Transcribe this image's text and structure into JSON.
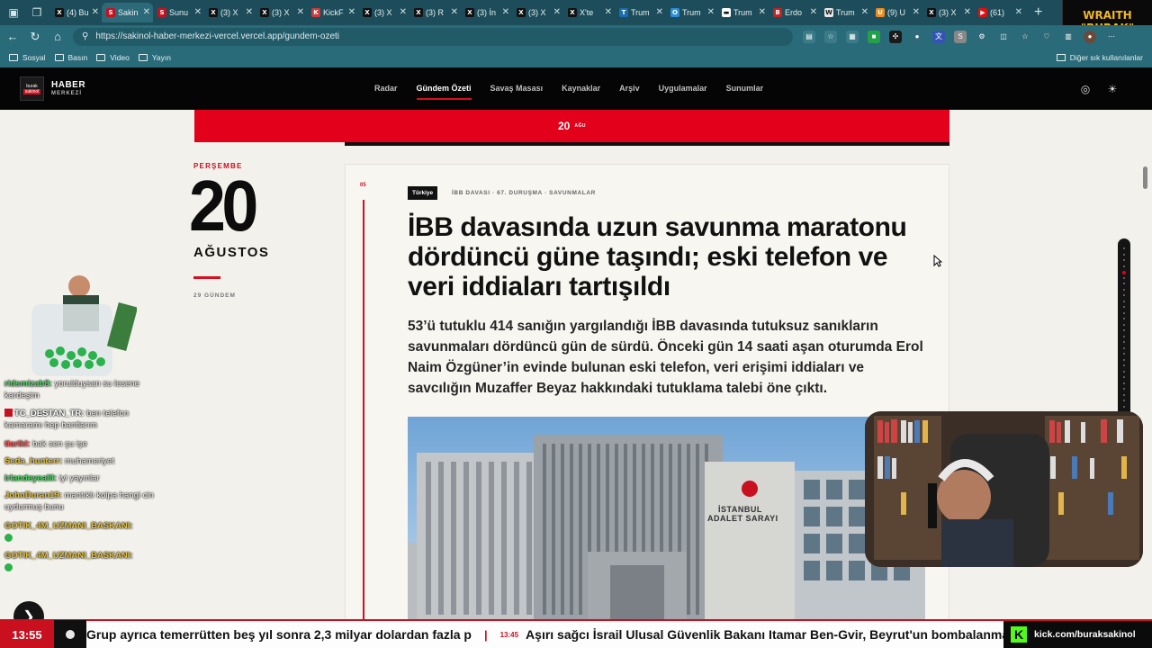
{
  "browser": {
    "tabs": [
      {
        "title": "(4) Bu",
        "fav_color": "#111111",
        "fav": "X"
      },
      {
        "title": "Sakin",
        "fav_color": "#c8101f",
        "fav": "S",
        "active": true
      },
      {
        "title": "Sunu",
        "fav_color": "#c8101f",
        "fav": "S"
      },
      {
        "title": "(3) X",
        "fav_color": "#111111",
        "fav": "X"
      },
      {
        "title": "(3) X",
        "fav_color": "#111111",
        "fav": "X"
      },
      {
        "title": "KickF",
        "fav_color": "#d13a3a",
        "fav": "K"
      },
      {
        "title": "(3) X",
        "fav_color": "#111111",
        "fav": "X"
      },
      {
        "title": "(3) R",
        "fav_color": "#111111",
        "fav": "X"
      },
      {
        "title": "(3) İn",
        "fav_color": "#111111",
        "fav": "X"
      },
      {
        "title": "(3) X",
        "fav_color": "#111111",
        "fav": "X"
      },
      {
        "title": "X'te",
        "fav_color": "#111111",
        "fav": "X"
      },
      {
        "title": "Trum",
        "fav_color": "#1b6db0",
        "fav": "T"
      },
      {
        "title": "Trum",
        "fav_color": "#2a8fd8",
        "fav": "O"
      },
      {
        "title": "Trum",
        "fav_color": "#ffffff",
        "fav": "▬"
      },
      {
        "title": "Erdo",
        "fav_color": "#c02323",
        "fav": "B"
      },
      {
        "title": "Trum",
        "fav_color": "#e8e8e8",
        "fav": "W"
      },
      {
        "title": "(9) U",
        "fav_color": "#f08a1c",
        "fav": "U"
      },
      {
        "title": "(3) X",
        "fav_color": "#111111",
        "fav": "X"
      },
      {
        "title": "(61)",
        "fav_color": "#e01010",
        "fav": "▶"
      }
    ],
    "url": "https://sakinol-haber-merkezi-vercel.vercel.app/gundem-ozeti",
    "bookmarks": [
      "Sosyal",
      "Basın",
      "Video",
      "Yayın"
    ],
    "bookmarks_right": "Diğer sık kullanılanlar"
  },
  "site": {
    "logo_title": "HABER",
    "logo_sub": "MERKEZİ",
    "logo_mark_top": "burak",
    "logo_mark_bottom": "sakinol",
    "nav": [
      "Radar",
      "Gündem Özeti",
      "Savaş Masası",
      "Kaynaklar",
      "Arşiv",
      "Uygulamalar",
      "Sunumlar"
    ],
    "nav_active": "Gündem Özeti"
  },
  "banner": {
    "day": "20",
    "month_short": "AĞU"
  },
  "date_column": {
    "weekday": "PERŞEMBE",
    "day": "20",
    "month": "AĞUSTOS",
    "count_label": "29 GÜNDEM"
  },
  "article": {
    "index": "05",
    "region_tag": "Türkiye",
    "meta": "İBB DAVASI · 67. DURUŞMA · SAVUNMALAR",
    "headline": "İBB davasında uzun savunma maratonu dördüncü güne taşındı; eski telefon ve veri iddiaları tartışıldı",
    "lede": "53’ü tutuklu 414 sanığın yargılandığı İBB davasında tutuksuz sanıkların savunmaları dördüncü gün de sürdü. Önceki gün 14 saati aşan oturumda Erol Naim Özgüner’in evinde bulunan eski telefon, veri erişimi iddiaları ve savcılığın Muzaffer Beyaz hakkındaki tutuklama talebi öne çıktı.",
    "image_sign_1": "İSTANBUL",
    "image_sign_2": "ADALET SARAYI"
  },
  "chat": [
    {
      "user": "ridsmizab8:",
      "user_color": "#4cd964",
      "msg": "yorulduysan su lesene kardeşim"
    },
    {
      "user": "TC_DESTAN_TR:",
      "user_color": "#ffffff",
      "msg": "ben telefon kamaramı hep bantlarım",
      "badge": true
    },
    {
      "user": "tlarikl:",
      "user_color": "#ff4d4d",
      "msg": "bak sen şu işe"
    },
    {
      "user": "Seda_hunterr:",
      "user_color": "#e6c33c",
      "msg": "muhameriyet"
    },
    {
      "user": "irlandeyealil:",
      "user_color": "#4cd964",
      "msg": "iyi yayınlar"
    },
    {
      "user": "JohnDuran19:",
      "user_color": "#e6c33c",
      "msg": "mantıklı kolpa hangi cin uydurmuş bunu"
    },
    {
      "user": "GOTIK_4M_UZMANI_BASKANI:",
      "user_color": "#e6c33c",
      "msg": ""
    },
    {
      "user": "GOTIK_4M_UZMANI_BASKANI:",
      "user_color": "#e6c33c",
      "msg": ""
    }
  ],
  "overlay": {
    "brand_1": "WRAITH",
    "brand_2": "\"BURAK\""
  },
  "ticker": {
    "clock": "13:55",
    "item_1": "Grup ayrıca temerrütten beş yıl sonra 2,3 milyar dolardan fazla p",
    "item_2_time": "13:45",
    "item_2": "Aşırı sağcı İsrail Ulusal Güvenlik Bakanı Itamar Ben-Gvir, Beyrut'un bombalanmas",
    "kick_url": "kick.com/buraksakinol"
  },
  "colors": {
    "accent": "#e3001b",
    "header_bg": "#050505",
    "page_bg": "#f3f1ec",
    "chrome": "#2a6b7a"
  }
}
